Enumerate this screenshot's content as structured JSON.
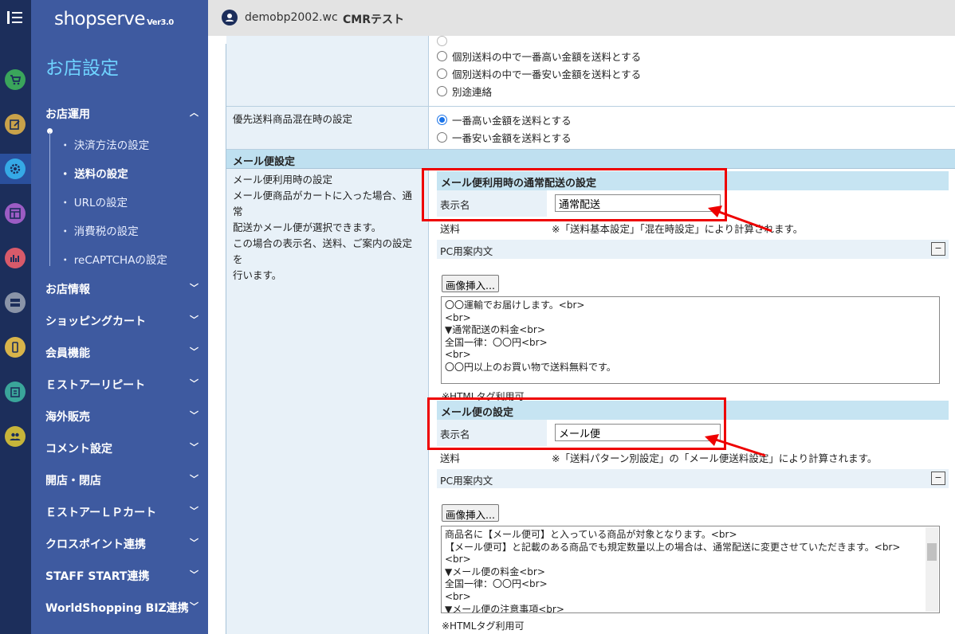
{
  "brand": {
    "name": "shopserve",
    "version": "Ver3.0"
  },
  "header": {
    "shop_id": "demobp2002.wc",
    "shop_name": "CMRテスト"
  },
  "nav": {
    "title": "お店設定",
    "sections": [
      {
        "label": "お店運用"
      },
      {
        "label": "お店情報"
      },
      {
        "label": "ショッピングカート"
      },
      {
        "label": "会員機能"
      },
      {
        "label": "Ｅストアーリピート"
      },
      {
        "label": "海外販売"
      },
      {
        "label": "コメント設定"
      },
      {
        "label": "開店・閉店"
      },
      {
        "label": "ＥストアーＬＰカート"
      },
      {
        "label": "クロスポイント連携"
      },
      {
        "label": "STAFF START連携"
      },
      {
        "label": "WorldShopping BIZ連携"
      }
    ],
    "sub_items": [
      {
        "label": "決済方法の設定"
      },
      {
        "label": "送料の設定"
      },
      {
        "label": "URLの設定"
      },
      {
        "label": "消費税の設定"
      },
      {
        "label": "reCAPTCHAの設定"
      }
    ]
  },
  "main": {
    "options_top": [
      "個別送料の中で一番高い金額を送料とする",
      "個別送料の中で一番安い金額を送料とする",
      "別途連絡"
    ],
    "priority_label": "優先送料商品混在時の設定",
    "priority_options": [
      "一番高い金額を送料とする",
      "一番安い金額を送料とする"
    ],
    "mail_section_title": "メール便設定",
    "mail_description": [
      "メール便利用時の設定",
      "メール便商品がカートに入った場合、通常",
      "配送かメール便が選択できます。",
      "この場合の表示名、送料、ご案内の設定を",
      "行います。"
    ],
    "normal_block": {
      "title": "メール便利用時の通常配送の設定",
      "display_name_label": "表示名",
      "display_name_value": "通常配送",
      "shipping_label": "送料",
      "shipping_text": "※「送料基本設定」「混在時設定」により計算されます。",
      "pc_label": "PC用案内文",
      "minus_label": "−",
      "insert_button": "画像挿入...",
      "lines": [
        "〇〇運輸でお届けします。<br>",
        "<br>",
        "▼通常配送の料金<br>",
        "全国一律：〇〇円<br>",
        "<br>",
        "〇〇円以上のお買い物で送料無料です。"
      ],
      "note": "※HTMLタグ利用可"
    },
    "mail_block": {
      "title": "メール便の設定",
      "display_name_label": "表示名",
      "display_name_value": "メール便",
      "shipping_label": "送料",
      "shipping_text": "※「送料パターン別設定」の「メール便送料設定」により計算されます。",
      "pc_label": "PC用案内文",
      "minus_label": "−",
      "insert_button": "画像挿入...",
      "lines": [
        "商品名に【メール便可】と入っている商品が対象となります。<br>",
        "【メール便可】と記載のある商品でも規定数量以上の場合は、通常配送に変更させていただきます。<br>",
        "<br>",
        "▼メール便の料金<br>",
        "全国一律：〇〇円<br>",
        "<br>",
        "▼メール便の注意事項<br>"
      ],
      "note": "※HTMLタグ利用可"
    }
  },
  "colors": {
    "rail": "#1c2e5b",
    "nav": "#3e5aa0",
    "accent": "#6fd3ff",
    "highlight": "#e00000"
  }
}
